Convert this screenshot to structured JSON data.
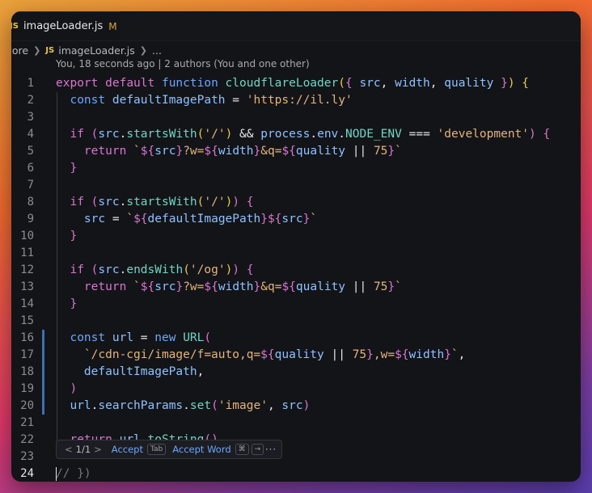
{
  "tab": {
    "badge": "JS",
    "filename": "imageLoader.js",
    "modified": "M"
  },
  "breadcrumb": {
    "folder": "core",
    "badge": "JS",
    "file": "imageLoader.js",
    "more": "..."
  },
  "blame": "You, 18 seconds ago | 2 authors (You and one other)",
  "gutter": {
    "modified_lines": [
      16,
      17,
      18,
      19,
      20
    ],
    "current_line": 24
  },
  "lines": [
    {
      "n": "1",
      "segs": [
        [
          "k",
          "export"
        ],
        [
          "p",
          " "
        ],
        [
          "k",
          "default"
        ],
        [
          "p",
          " "
        ],
        [
          "kb",
          "function"
        ],
        [
          "p",
          " "
        ],
        [
          "fn",
          "cloudflareLoader"
        ],
        [
          "br",
          "("
        ],
        [
          "br2",
          "{"
        ],
        [
          "p",
          " "
        ],
        [
          "v",
          "src"
        ],
        [
          "p",
          ", "
        ],
        [
          "v",
          "width"
        ],
        [
          "p",
          ", "
        ],
        [
          "v",
          "quality"
        ],
        [
          "p",
          " "
        ],
        [
          "br2",
          "}"
        ],
        [
          "br",
          ")"
        ],
        [
          "p",
          " "
        ],
        [
          "br",
          "{"
        ]
      ]
    },
    {
      "n": "2",
      "segs": [
        [
          "p",
          "  "
        ],
        [
          "kb",
          "const"
        ],
        [
          "p",
          " "
        ],
        [
          "v",
          "defaultImagePath"
        ],
        [
          "p",
          " = "
        ],
        [
          "s",
          "'https://il.ly'"
        ]
      ]
    },
    {
      "n": "3",
      "segs": []
    },
    {
      "n": "4",
      "segs": [
        [
          "p",
          "  "
        ],
        [
          "k",
          "if"
        ],
        [
          "p",
          " "
        ],
        [
          "br2",
          "("
        ],
        [
          "v",
          "src"
        ],
        [
          "p",
          "."
        ],
        [
          "f",
          "startsWith"
        ],
        [
          "br",
          "("
        ],
        [
          "s",
          "'/'"
        ],
        [
          "br",
          ")"
        ],
        [
          "p",
          " && "
        ],
        [
          "v",
          "process"
        ],
        [
          "p",
          "."
        ],
        [
          "v",
          "env"
        ],
        [
          "p",
          "."
        ],
        [
          "ty",
          "NODE_ENV"
        ],
        [
          "p",
          " === "
        ],
        [
          "s",
          "'development'"
        ],
        [
          "br2",
          ")"
        ],
        [
          "p",
          " "
        ],
        [
          "br2",
          "{"
        ]
      ]
    },
    {
      "n": "5",
      "segs": [
        [
          "p",
          "    "
        ],
        [
          "k",
          "return"
        ],
        [
          "p",
          " "
        ],
        [
          "s",
          "`"
        ],
        [
          "k",
          "${"
        ],
        [
          "v",
          "src"
        ],
        [
          "k",
          "}"
        ],
        [
          "s",
          "?w="
        ],
        [
          "k",
          "${"
        ],
        [
          "v",
          "width"
        ],
        [
          "k",
          "}"
        ],
        [
          "s",
          "&q="
        ],
        [
          "k",
          "${"
        ],
        [
          "v",
          "quality"
        ],
        [
          "p",
          " || "
        ],
        [
          "n",
          "75"
        ],
        [
          "k",
          "}"
        ],
        [
          "s",
          "`"
        ]
      ]
    },
    {
      "n": "6",
      "segs": [
        [
          "p",
          "  "
        ],
        [
          "br2",
          "}"
        ]
      ]
    },
    {
      "n": "7",
      "segs": []
    },
    {
      "n": "8",
      "segs": [
        [
          "p",
          "  "
        ],
        [
          "k",
          "if"
        ],
        [
          "p",
          " "
        ],
        [
          "br2",
          "("
        ],
        [
          "v",
          "src"
        ],
        [
          "p",
          "."
        ],
        [
          "f",
          "startsWith"
        ],
        [
          "br",
          "("
        ],
        [
          "s",
          "'/'"
        ],
        [
          "br",
          ")"
        ],
        [
          "br2",
          ")"
        ],
        [
          "p",
          " "
        ],
        [
          "br2",
          "{"
        ]
      ]
    },
    {
      "n": "9",
      "segs": [
        [
          "p",
          "    "
        ],
        [
          "v",
          "src"
        ],
        [
          "p",
          " = "
        ],
        [
          "s",
          "`"
        ],
        [
          "k",
          "${"
        ],
        [
          "v",
          "defaultImagePath"
        ],
        [
          "k",
          "}${"
        ],
        [
          "v",
          "src"
        ],
        [
          "k",
          "}"
        ],
        [
          "s",
          "`"
        ]
      ]
    },
    {
      "n": "10",
      "segs": [
        [
          "p",
          "  "
        ],
        [
          "br2",
          "}"
        ]
      ]
    },
    {
      "n": "11",
      "segs": []
    },
    {
      "n": "12",
      "segs": [
        [
          "p",
          "  "
        ],
        [
          "k",
          "if"
        ],
        [
          "p",
          " "
        ],
        [
          "br2",
          "("
        ],
        [
          "v",
          "src"
        ],
        [
          "p",
          "."
        ],
        [
          "f",
          "endsWith"
        ],
        [
          "br",
          "("
        ],
        [
          "s",
          "'/og'"
        ],
        [
          "br",
          ")"
        ],
        [
          "br2",
          ")"
        ],
        [
          "p",
          " "
        ],
        [
          "br2",
          "{"
        ]
      ]
    },
    {
      "n": "13",
      "segs": [
        [
          "p",
          "    "
        ],
        [
          "k",
          "return"
        ],
        [
          "p",
          " "
        ],
        [
          "s",
          "`"
        ],
        [
          "k",
          "${"
        ],
        [
          "v",
          "src"
        ],
        [
          "k",
          "}"
        ],
        [
          "s",
          "?w="
        ],
        [
          "k",
          "${"
        ],
        [
          "v",
          "width"
        ],
        [
          "k",
          "}"
        ],
        [
          "s",
          "&q="
        ],
        [
          "k",
          "${"
        ],
        [
          "v",
          "quality"
        ],
        [
          "p",
          " || "
        ],
        [
          "n",
          "75"
        ],
        [
          "k",
          "}"
        ],
        [
          "s",
          "`"
        ]
      ]
    },
    {
      "n": "14",
      "segs": [
        [
          "p",
          "  "
        ],
        [
          "br2",
          "}"
        ]
      ]
    },
    {
      "n": "15",
      "segs": []
    },
    {
      "n": "16",
      "segs": [
        [
          "p",
          "  "
        ],
        [
          "kb",
          "const"
        ],
        [
          "p",
          " "
        ],
        [
          "v",
          "url"
        ],
        [
          "p",
          " = "
        ],
        [
          "kb",
          "new"
        ],
        [
          "p",
          " "
        ],
        [
          "ty",
          "URL"
        ],
        [
          "br2",
          "("
        ]
      ]
    },
    {
      "n": "17",
      "segs": [
        [
          "p",
          "    "
        ],
        [
          "s",
          "`/cdn-cgi/image/f=auto,q="
        ],
        [
          "k",
          "${"
        ],
        [
          "v",
          "quality"
        ],
        [
          "p",
          " || "
        ],
        [
          "n",
          "75"
        ],
        [
          "k",
          "}"
        ],
        [
          "s",
          ",w="
        ],
        [
          "k",
          "${"
        ],
        [
          "v",
          "width"
        ],
        [
          "k",
          "}"
        ],
        [
          "s",
          "`"
        ],
        [
          "p",
          ","
        ]
      ]
    },
    {
      "n": "18",
      "segs": [
        [
          "p",
          "    "
        ],
        [
          "v",
          "defaultImagePath"
        ],
        [
          "p",
          ","
        ]
      ]
    },
    {
      "n": "19",
      "segs": [
        [
          "p",
          "  "
        ],
        [
          "br2",
          ")"
        ]
      ]
    },
    {
      "n": "20",
      "segs": [
        [
          "p",
          "  "
        ],
        [
          "v",
          "url"
        ],
        [
          "p",
          "."
        ],
        [
          "v",
          "searchParams"
        ],
        [
          "p",
          "."
        ],
        [
          "f",
          "set"
        ],
        [
          "br2",
          "("
        ],
        [
          "s",
          "'image'"
        ],
        [
          "p",
          ", "
        ],
        [
          "v",
          "src"
        ],
        [
          "br2",
          ")"
        ]
      ]
    },
    {
      "n": "21",
      "segs": []
    },
    {
      "n": "22",
      "segs": [
        [
          "p",
          "  "
        ],
        [
          "k",
          "return"
        ],
        [
          "p",
          " "
        ],
        [
          "v",
          "url"
        ],
        [
          "p",
          "."
        ],
        [
          "f",
          "toString"
        ],
        [
          "br2",
          "()"
        ]
      ]
    },
    {
      "n": "23",
      "segs": []
    },
    {
      "n": "24",
      "segs": [
        [
          "c",
          "// })"
        ]
      ]
    }
  ],
  "suggest": {
    "back": "<",
    "count": "1/1",
    "forward": ">",
    "accept": "Accept",
    "accept_key": "Tab",
    "accept_word": "Accept Word",
    "word_key1": "⌘",
    "word_key2": "→",
    "more": "···"
  }
}
